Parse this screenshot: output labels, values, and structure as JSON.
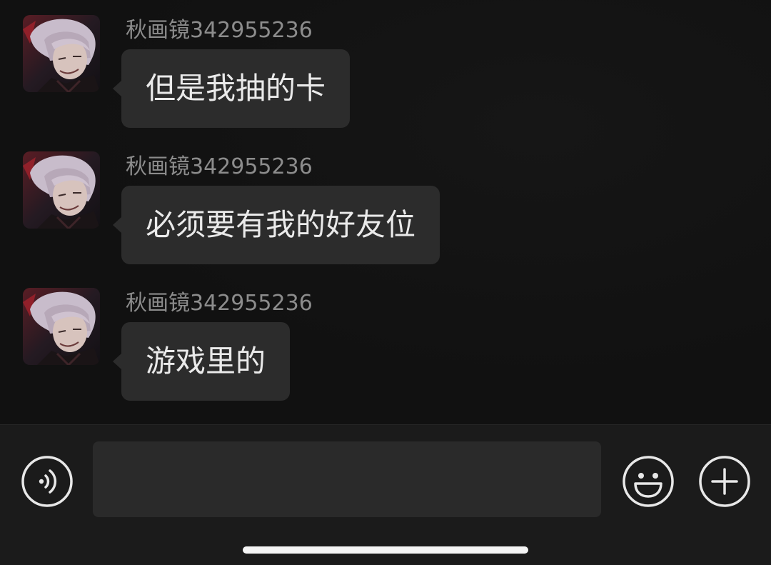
{
  "messages": [
    {
      "sender": "秋画镜342955236",
      "text": "但是我抽的卡"
    },
    {
      "sender": "秋画镜342955236",
      "text": "必须要有我的好友位"
    },
    {
      "sender": "秋画镜342955236",
      "text": "游戏里的"
    }
  ],
  "input": {
    "value": "",
    "placeholder": ""
  },
  "icons": {
    "voice": "voice-icon",
    "emoji": "emoji-icon",
    "plus": "plus-icon",
    "avatar": "avatar-image"
  },
  "colors": {
    "background": "#111111",
    "bubble": "#2c2c2c",
    "sender_text": "#8c8c8c",
    "message_text": "#eaeaea",
    "input_bar": "#1b1b1b",
    "input_field": "#2a2a2a",
    "icon_stroke": "#e8e8e8"
  }
}
